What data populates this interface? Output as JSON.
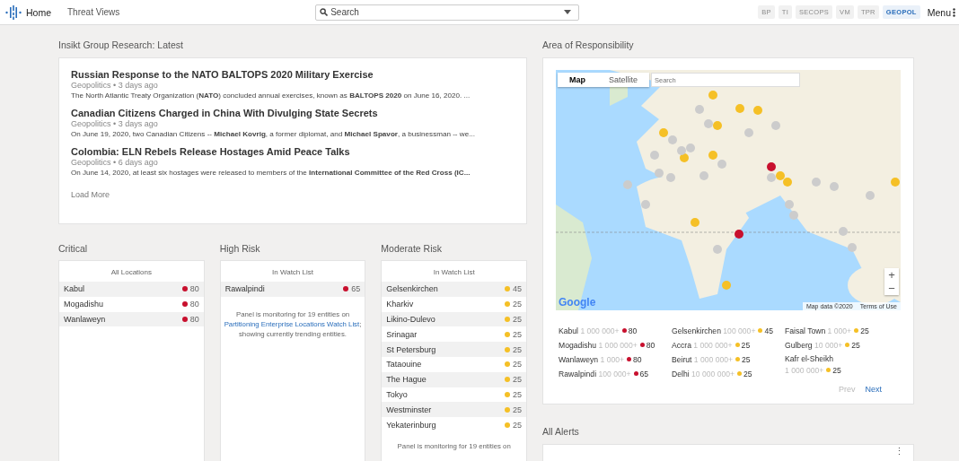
{
  "top_bar": {
    "home": "Home",
    "nav_links": [
      "Threat Views"
    ],
    "search": {
      "placeholder": "Search"
    },
    "tabs": [
      {
        "label": "BP",
        "selected": false
      },
      {
        "label": "TI",
        "selected": false
      },
      {
        "label": "SECOPS",
        "selected": false
      },
      {
        "label": "VM",
        "selected": false
      },
      {
        "label": "TPR",
        "selected": false
      },
      {
        "label": "GEOPOL",
        "selected": true
      }
    ],
    "menu": "Menu"
  },
  "research": {
    "title": "Insikt Group Research: Latest",
    "articles": [
      {
        "title": "Russian Response to the NATO BALTOPS 2020 Military Exercise",
        "meta": "Geopolitics • 3 days ago",
        "snippet": "The North Atlantic Treaty Organization (**NATO**) concluded annual exercises, known as **BALTOPS 2020** on June 16, 2020. ..."
      },
      {
        "title": "Canadian Citizens Charged in China With Divulging State Secrets",
        "meta": "Geopolitics • 3 days ago",
        "snippet": "On June 19, 2020, two Canadian Citizens -- **Michael Kovrig**, a former diplomat, and **Michael Spavor**, a businessman -- we..."
      },
      {
        "title": "Colombia: ELN Rebels Release Hostages Amid Peace Talks",
        "meta": "Geopolitics • 6 days ago",
        "snippet": "On June 14, 2020, at least six hostages were released to members of the **International Committee of the Red Cross (IC...**"
      }
    ],
    "load_more": "Load More"
  },
  "risk_panels": [
    {
      "title": "Critical",
      "subtitle": "All Locations",
      "rows": [
        {
          "name": "Kabul",
          "score": "80",
          "color": "#c8102e"
        },
        {
          "name": "Mogadishu",
          "score": "80",
          "color": "#c8102e"
        },
        {
          "name": "Wanlaweyn",
          "score": "80",
          "color": "#c8102e"
        }
      ]
    },
    {
      "title": "High Risk",
      "subtitle": "In Watch List",
      "rows": [
        {
          "name": "Rawalpindi",
          "score": "65",
          "color": "#c8102e"
        }
      ],
      "note": {
        "before": "Panel is monitoring for 19 entities on",
        "link": "Partitioning Enterprise Locations Watch List",
        "after": "; showing currently trending entities."
      }
    },
    {
      "title": "Moderate Risk",
      "subtitle": "In Watch List",
      "rows": [
        {
          "name": "Gelsenkirchen",
          "score": "45",
          "color": "#f5c026"
        },
        {
          "name": "Kharkiv",
          "score": "25",
          "color": "#f5c026"
        },
        {
          "name": "Likino-Dulevo",
          "score": "25",
          "color": "#f5c026"
        },
        {
          "name": "Srinagar",
          "score": "25",
          "color": "#f5c026"
        },
        {
          "name": "St Petersburg",
          "score": "25",
          "color": "#f5c026"
        },
        {
          "name": "Tataouine",
          "score": "25",
          "color": "#f5c026"
        },
        {
          "name": "The Hague",
          "score": "25",
          "color": "#f5c026"
        },
        {
          "name": "Tokyo",
          "score": "25",
          "color": "#f5c026"
        },
        {
          "name": "Westminster",
          "score": "25",
          "color": "#f5c026"
        },
        {
          "name": "Yekaterinburg",
          "score": "25",
          "color": "#f5c026"
        }
      ],
      "note": {
        "before": "Panel is monitoring for 19 entities on"
      }
    }
  ],
  "area": {
    "title": "Area of Responsibility",
    "map": {
      "tabs": [
        {
          "label": "Map",
          "selected": true
        },
        {
          "label": "Satellite",
          "selected": false
        }
      ],
      "search": {
        "placeholder": "Search"
      },
      "zoom_in": "+",
      "zoom_out": "−",
      "logo": "Google",
      "attribution": "Map data ©2020",
      "terms": "Terms of Use"
    },
    "legend": [
      {
        "name": "Kabul",
        "population": "1 000 000+",
        "score": "80",
        "color": "#c8102e"
      },
      {
        "name": "Mogadishu",
        "population": "1 000 000+",
        "score": "80",
        "color": "#c8102e"
      },
      {
        "name": "Wanlaweyn",
        "population": "1 000+",
        "score": "80",
        "color": "#c8102e"
      },
      {
        "name": "Rawalpindi",
        "population": "100 000+",
        "score": "65",
        "color": "#c8102e"
      },
      {
        "name": "Gelsenkirchen",
        "population": "100 000+",
        "score": "45",
        "color": "#f5c026"
      },
      {
        "name": "Accra",
        "population": "1 000 000+",
        "score": "25",
        "color": "#f5c026"
      },
      {
        "name": "Beirut",
        "population": "1 000 000+",
        "score": "25",
        "color": "#f5c026"
      },
      {
        "name": "Delhi",
        "population": "10 000 000+",
        "score": "25",
        "color": "#f5c026"
      },
      {
        "name": "Faisal Town",
        "population": "1 000+",
        "score": "25",
        "color": "#f5c026"
      },
      {
        "name": "Gulberg",
        "population": "10 000+",
        "score": "25",
        "color": "#f5c026"
      },
      {
        "name": "Kafr el-Sheikh",
        "population": "1 000 000+",
        "score": "25",
        "color": "#f5c026"
      }
    ],
    "pager": [
      {
        "label": "Prev",
        "disabled": true
      },
      {
        "label": "Next",
        "disabled": false
      }
    ]
  },
  "alerts": {
    "title": "All Alerts",
    "menu": "⋮"
  }
}
